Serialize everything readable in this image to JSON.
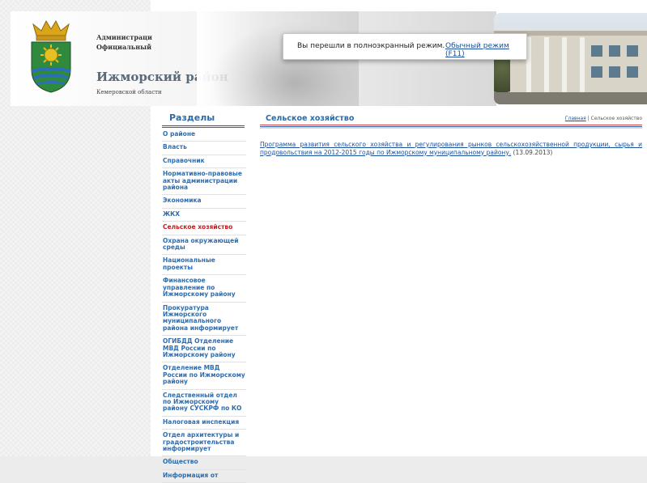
{
  "header": {
    "admin_line_1": "Администраци",
    "admin_line_2": "Официальный",
    "district_name": "Ижморский район",
    "region": "Кемеровской области"
  },
  "fullscreen_notice": {
    "message": "Вы перешли в полноэкранный режим.",
    "exit_link": "Обычный режим (F11)"
  },
  "sidebar": {
    "title": "Разделы",
    "items": [
      {
        "label": "О районе"
      },
      {
        "label": "Власть"
      },
      {
        "label": "Справочник"
      },
      {
        "label": "Нормативно-правовые акты администрации района"
      },
      {
        "label": "Экономика"
      },
      {
        "label": "ЖКХ"
      },
      {
        "label": "Сельское хозяйство"
      },
      {
        "label": "Охрана окружающей среды"
      },
      {
        "label": "Национальные проекты"
      },
      {
        "label": "Финансовое управление по Ижморскому району"
      },
      {
        "label": "Прокуратура Ижморского муниципального района информирует"
      },
      {
        "label": "ОГИБДД Отделение МВД России по Ижморскому району"
      },
      {
        "label": "Отделение МВД России по Ижморскому району"
      },
      {
        "label": "Следственный отдел по Ижморскому району СУСКРФ по КО"
      },
      {
        "label": "Налоговая инспекция"
      },
      {
        "label": "Отдел архитектуры и градостроительства информирует"
      },
      {
        "label": "Общество"
      },
      {
        "label": "Информация от"
      }
    ]
  },
  "content": {
    "title": "Сельское хозяйство",
    "breadcrumb_home": "Главная",
    "breadcrumb_separator": " | ",
    "breadcrumb_current": "Сельское хозяйство",
    "document_link": "Программа развития сельского хозяйства и регулирования рынков сельскохозяйственной продукции, сырья и продовольствия на 2012-2015 годы по Ижморскому муниципальному району.",
    "document_date": " (13.09.2013)"
  },
  "colors": {
    "nav_link": "#2f6db0",
    "nav_active": "#c41e1e",
    "title_blue": "#2e6aa5"
  }
}
